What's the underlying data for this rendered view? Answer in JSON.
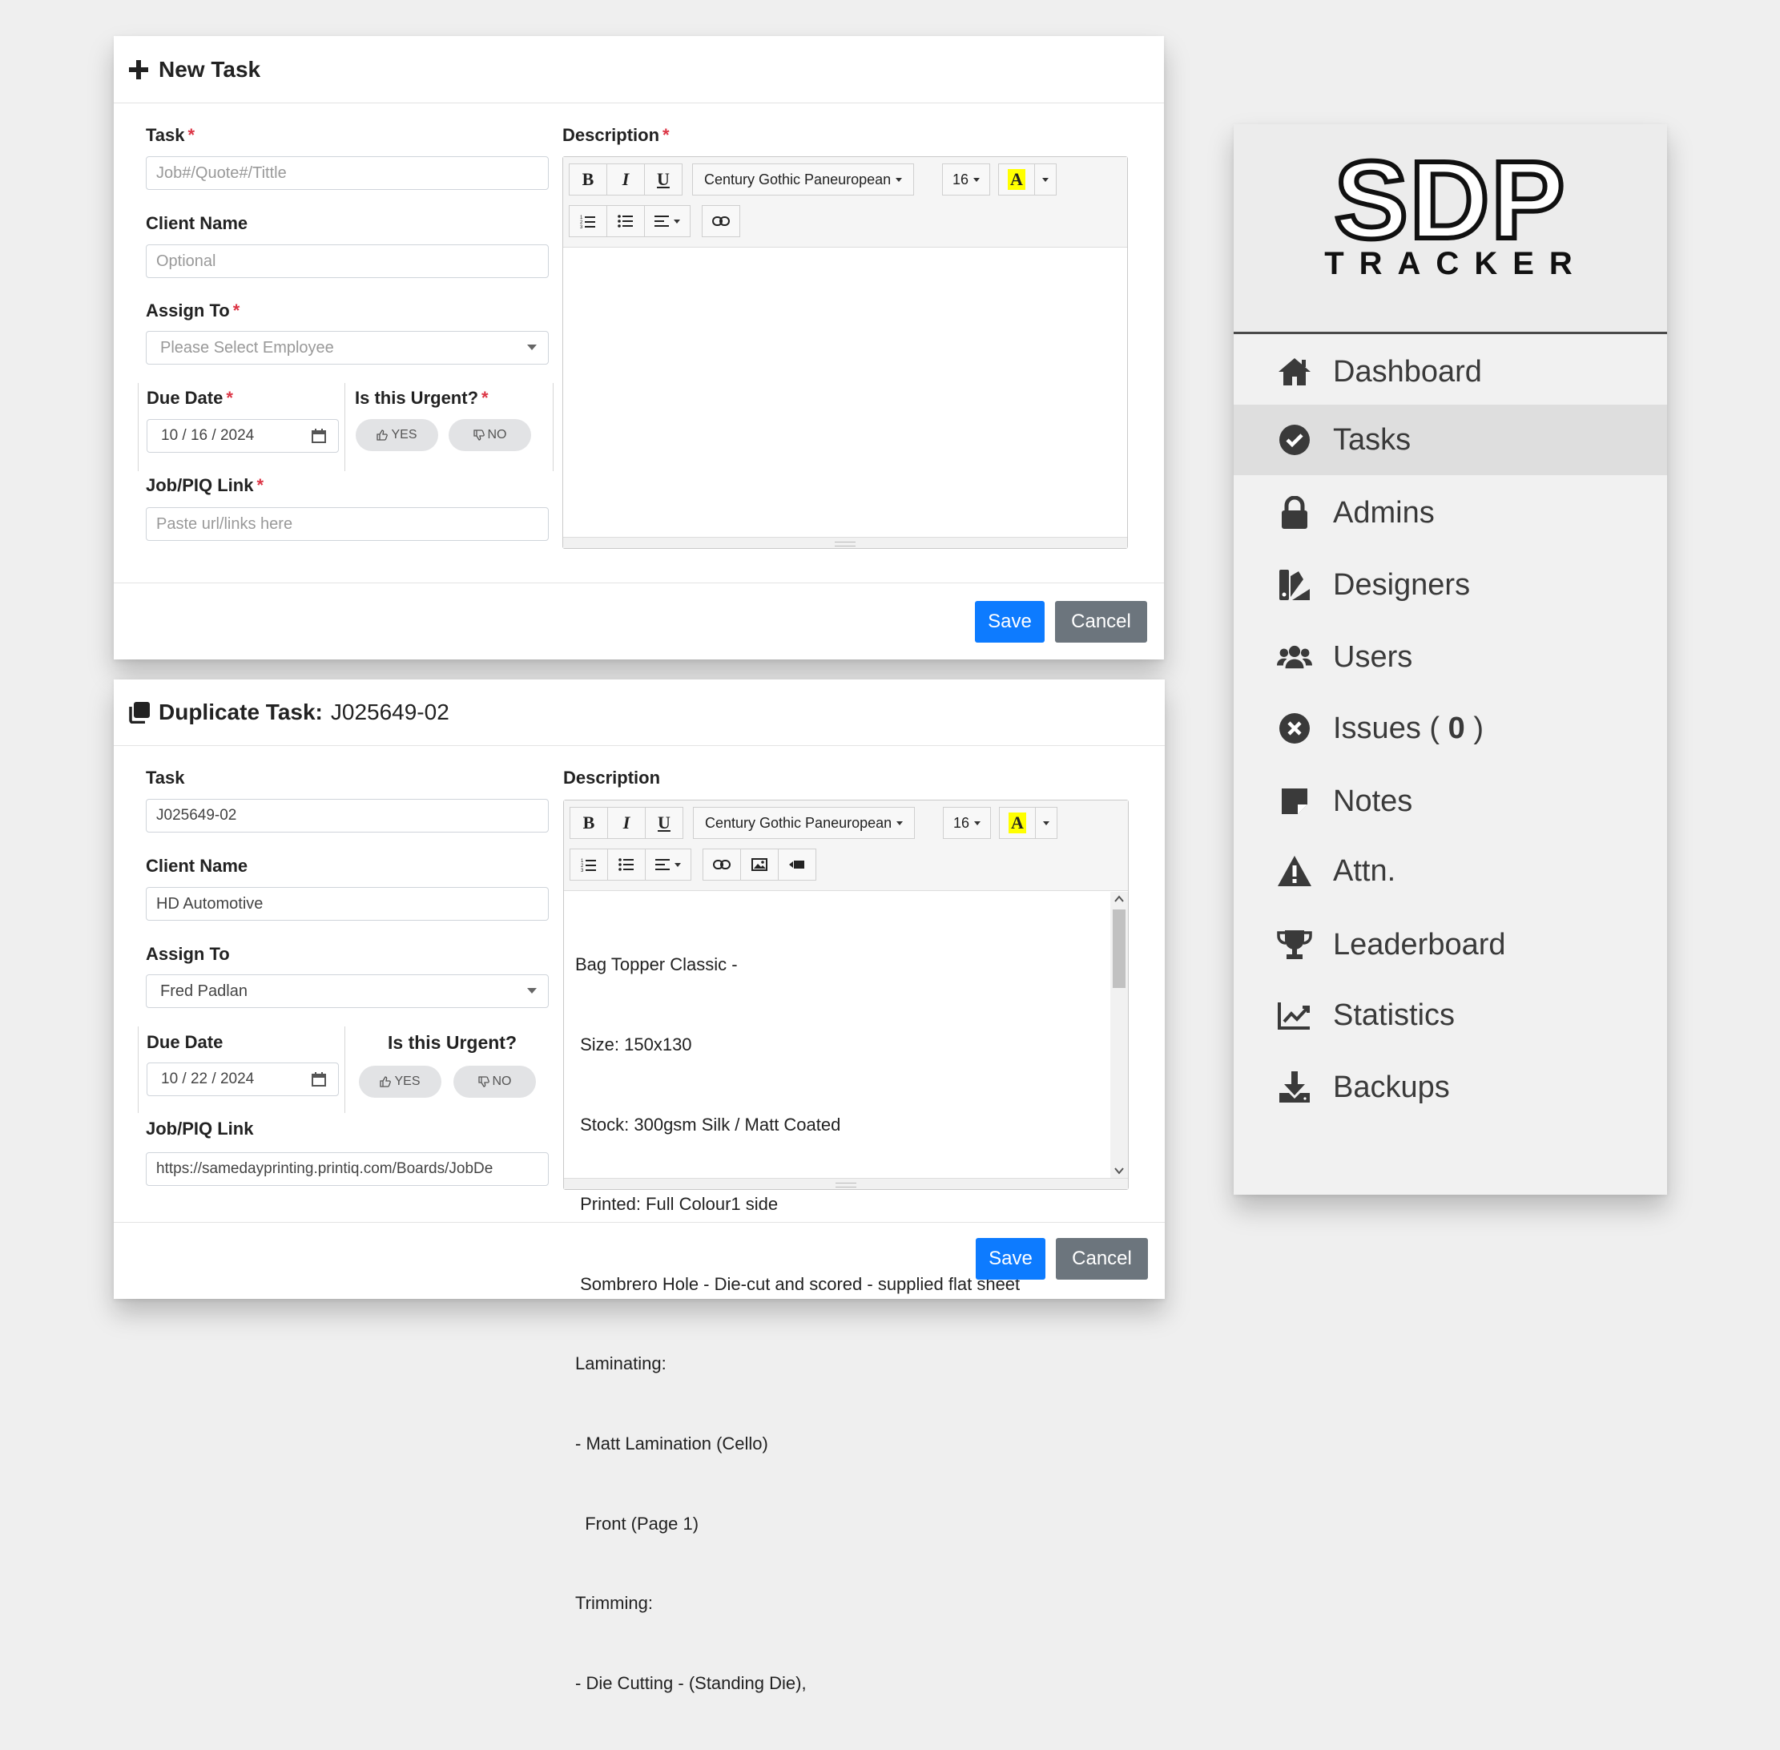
{
  "new_task": {
    "title": "New Task",
    "task_label": "Task",
    "task_placeholder": "Job#/Quote#/Tittle",
    "client_label": "Client Name",
    "client_placeholder": "Optional",
    "assign_label": "Assign To",
    "assign_value": "Please Select Employee",
    "due_label": "Due Date",
    "due_value": "10 / 16 / 2024",
    "urgent_label": "Is this Urgent?",
    "yes_label": "YES",
    "no_label": "NO",
    "link_label": "Job/PIQ Link",
    "link_placeholder": "Paste url/links here",
    "desc_label": "Description",
    "font_name": "Century Gothic Paneuropean",
    "font_size": "16",
    "save": "Save",
    "cancel": "Cancel"
  },
  "duplicate_task": {
    "title": "Duplicate Task:",
    "task_id": "J025649-02",
    "task_label": "Task",
    "task_value": "J025649-02",
    "client_label": "Client Name",
    "client_value": "HD Automotive",
    "assign_label": "Assign To",
    "assign_value": "Fred Padlan",
    "due_label": "Due Date",
    "due_value": "10 / 22 / 2024",
    "urgent_label": "Is this Urgent?",
    "yes_label": "YES",
    "no_label": "NO",
    "link_label": "Job/PIQ Link",
    "link_value": "https://samedayprinting.printiq.com/Boards/JobDe",
    "desc_label": "Description",
    "font_name": "Century Gothic Paneuropean",
    "font_size": "16",
    "description_lines": [
      "Bag Topper Classic -",
      " Size: 150x130",
      " Stock: 300gsm Silk / Matt Coated",
      " Printed: Full Colour1 side",
      " Sombrero Hole - Die-cut and scored - supplied flat sheet",
      "Laminating:",
      "- Matt Lamination (Cello)",
      "  Front (Page 1)",
      "Trimming:",
      "- Die Cutting - (Standing Die),"
    ],
    "save": "Save",
    "cancel": "Cancel"
  },
  "sidebar": {
    "logo_main": "SDP",
    "logo_sub": "TRACKER",
    "items": [
      {
        "label": "Dashboard",
        "icon": "home-icon"
      },
      {
        "label": "Tasks",
        "icon": "check-circle-icon",
        "active": true
      },
      {
        "label": "Admins",
        "icon": "lock-icon"
      },
      {
        "label": "Designers",
        "icon": "swatch-icon"
      },
      {
        "label": "Users",
        "icon": "users-icon"
      },
      {
        "label": "Issues (",
        "count": "0",
        "suffix": ")",
        "icon": "times-circle-icon"
      },
      {
        "label": "Notes",
        "icon": "sticky-note-icon"
      },
      {
        "label": "Attn.",
        "icon": "warning-icon"
      },
      {
        "label": "Leaderboard",
        "icon": "trophy-icon"
      },
      {
        "label": "Statistics",
        "icon": "chart-line-icon"
      },
      {
        "label": "Backups",
        "icon": "download-icon"
      }
    ]
  },
  "colors": {
    "primary": "#0d7bff",
    "secondary": "#6c757d",
    "required": "#dc3545",
    "highlight": "#ffff00"
  }
}
